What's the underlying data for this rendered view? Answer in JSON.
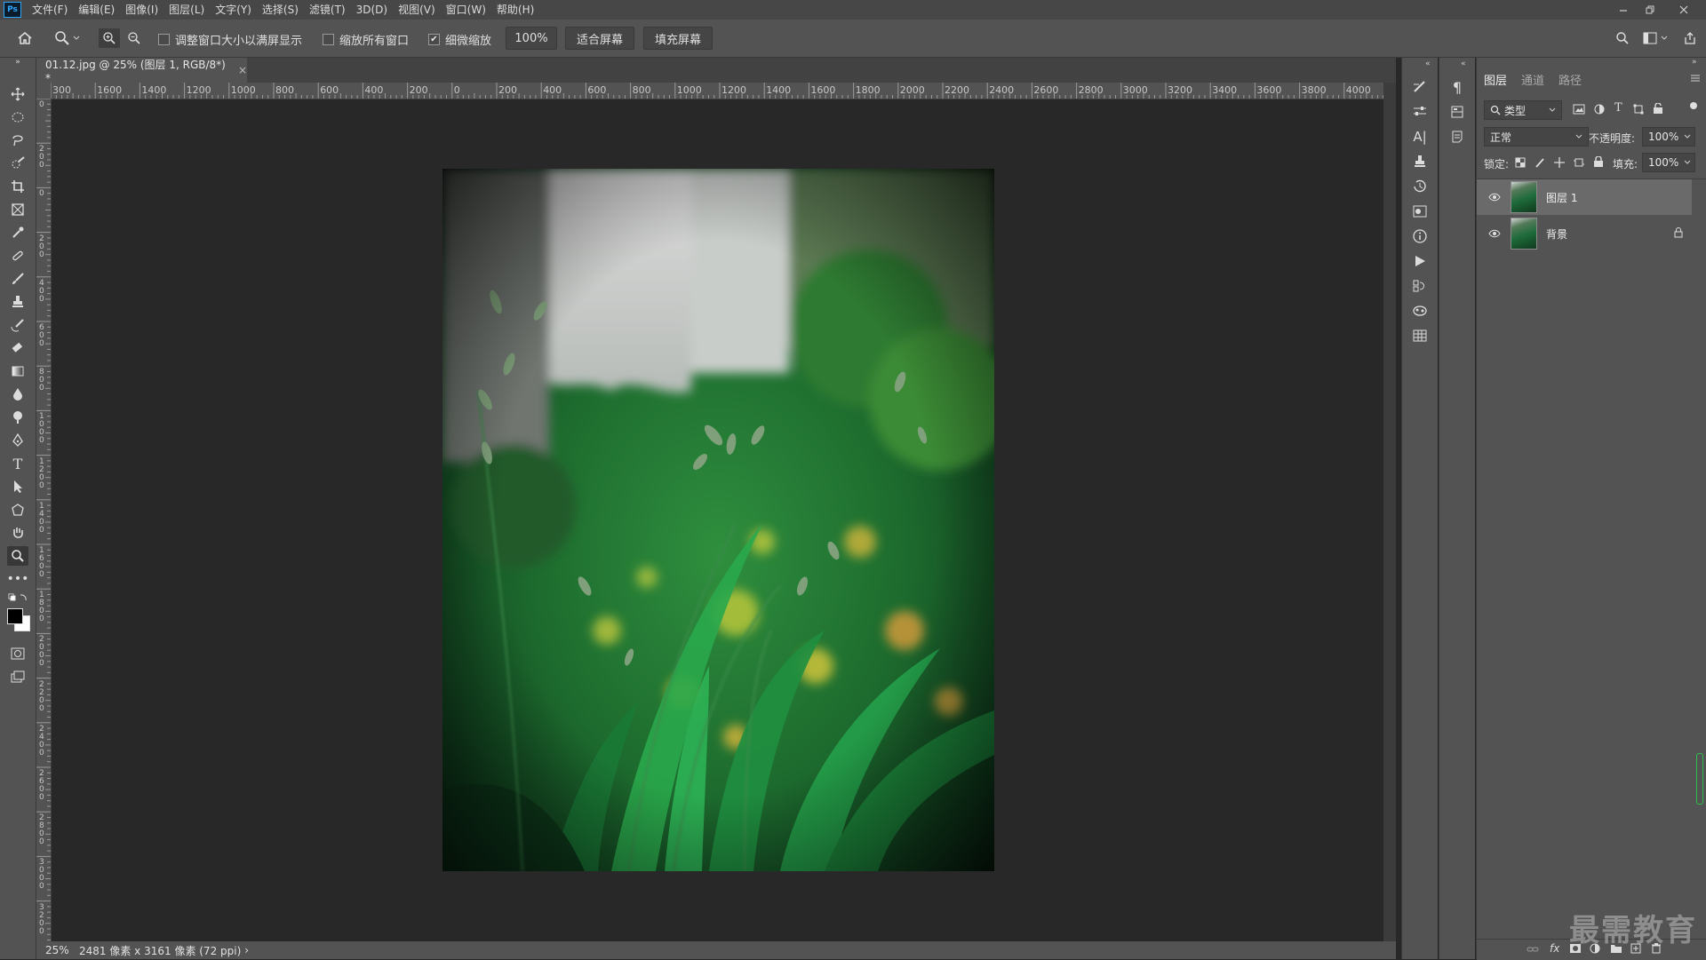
{
  "app": {
    "logo": "Ps"
  },
  "menu": [
    "文件(F)",
    "编辑(E)",
    "图像(I)",
    "图层(L)",
    "文字(Y)",
    "选择(S)",
    "滤镜(T)",
    "3D(D)",
    "视图(V)",
    "窗口(W)",
    "帮助(H)"
  ],
  "options": {
    "resize_windows_label": "调整窗口大小以满屏显示",
    "zoom_all_label": "缩放所有窗口",
    "scrubby_label": "细微缩放",
    "scrubby_checked": true,
    "zoom_value": "100%",
    "fit_screen": "适合屏幕",
    "fill_screen": "填充屏幕"
  },
  "document": {
    "tab_title": "01.12.jpg @ 25% (图层 1, RGB/8*) *",
    "close": "×"
  },
  "ruler": {
    "h_labels": [
      "300",
      "1600",
      "1400",
      "1200",
      "1000",
      "800",
      "600",
      "400",
      "200",
      "0",
      "200",
      "400",
      "600",
      "800",
      "1000",
      "1200",
      "1400",
      "1600",
      "1800",
      "2000",
      "2200",
      "2400",
      "2600",
      "2800",
      "3000",
      "3200",
      "3400",
      "3600",
      "3800",
      "4000",
      "4"
    ],
    "v_labels": [
      "0",
      "2 0 0",
      "0",
      "2 0 0",
      "4 0 0",
      "6 0 0",
      "8 0 0",
      "1 0 0 0",
      "1 2 0 0",
      "1 4 0 0",
      "1 6 0 0",
      "1 8 0 0",
      "2 0 0 0",
      "2 2 0 0",
      "2 4 0 0",
      "2 6 0 0",
      "2 8 0 0",
      "3 0 0 0",
      "3 2 0 0"
    ]
  },
  "status": {
    "zoom": "25%",
    "info": "2481 像素 x 3161 像素 (72 ppi)",
    "arrow": "›"
  },
  "layers_panel": {
    "tabs": [
      "图层",
      "通道",
      "路径"
    ],
    "filter_kind": "类型",
    "blend_mode": "正常",
    "opacity_label": "不透明度:",
    "opacity_value": "100%",
    "lock_label": "锁定:",
    "fill_label": "填充:",
    "fill_value": "100%",
    "layers": [
      {
        "name": "图层 1",
        "selected": true,
        "locked": false
      },
      {
        "name": "背景",
        "selected": false,
        "locked": true
      }
    ]
  },
  "watermark": "最需教育",
  "colors": {
    "accent": "#31a8ff",
    "panel": "#535353",
    "canvas": "#282828"
  }
}
